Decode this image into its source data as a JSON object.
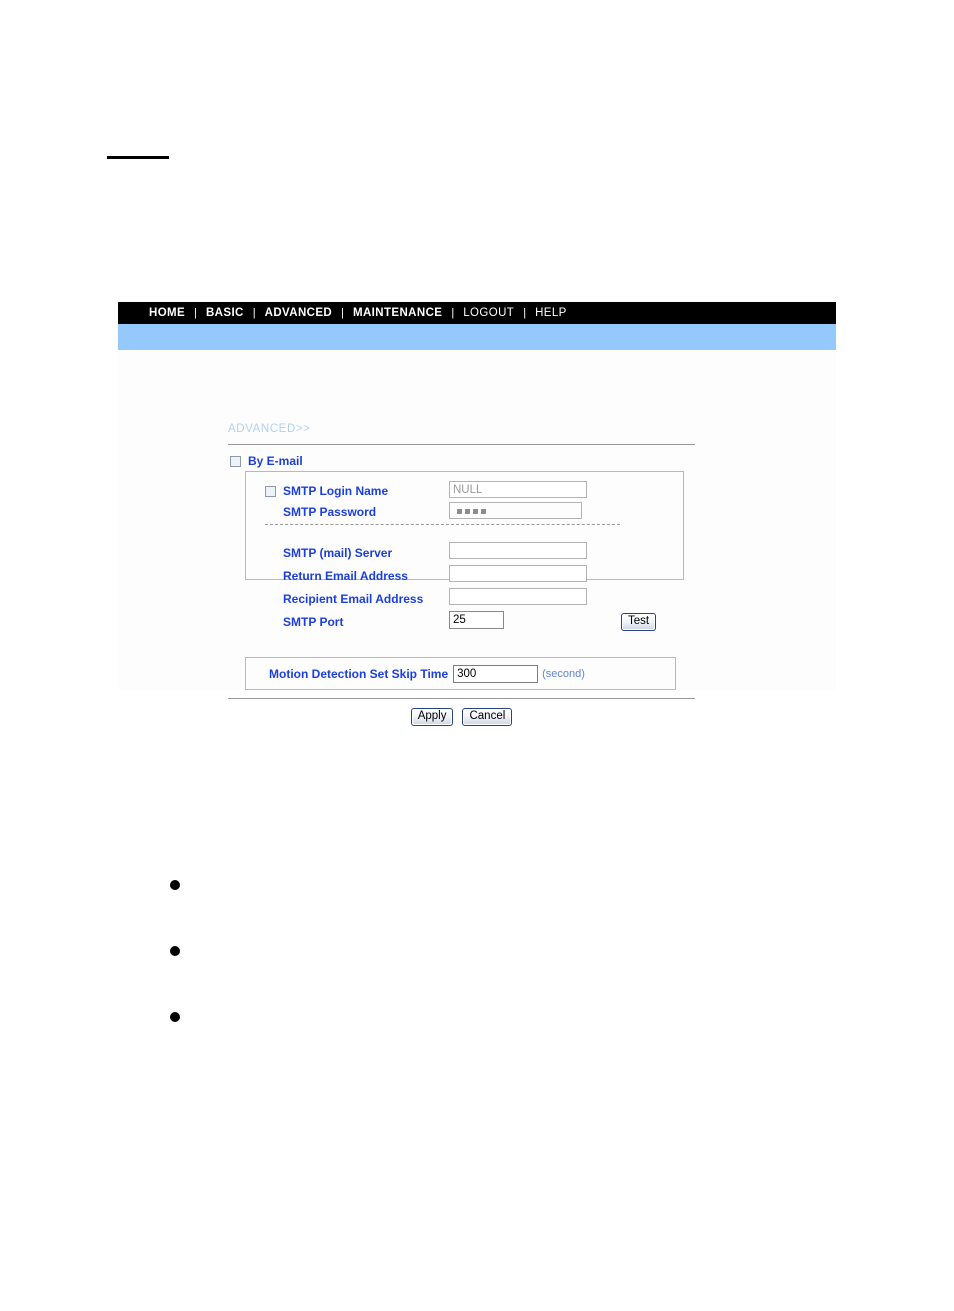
{
  "page": {
    "heading_rule": true,
    "bullets": [
      "",
      "",
      ""
    ]
  },
  "nav": {
    "separator": "|",
    "items": [
      {
        "label": "HOME",
        "weight": "strong"
      },
      {
        "label": "BASIC",
        "weight": "strong"
      },
      {
        "label": "ADVANCED",
        "weight": "strong"
      },
      {
        "label": "MAINTENANCE",
        "weight": "strong"
      },
      {
        "label": "LOGOUT",
        "weight": "light"
      },
      {
        "label": "HELP",
        "weight": "light"
      }
    ]
  },
  "content": {
    "breadcrumb": "ADVANCED>>",
    "master": {
      "label": "By E-mail",
      "checked": false
    },
    "smtp": {
      "login_name": {
        "label": "SMTP Login Name",
        "checked": false,
        "value": "NULL"
      },
      "password": {
        "label": "SMTP Password",
        "value": "••••",
        "dots": 4
      },
      "server": {
        "label": "SMTP (mail) Server",
        "value": "",
        "placeholder": ""
      },
      "return_email": {
        "label": "Return Email Address",
        "value": "",
        "placeholder": ""
      },
      "recipient_email": {
        "label": "Recipient Email Address",
        "value": "",
        "placeholder": ""
      },
      "port": {
        "label": "SMTP Port",
        "value": "25"
      },
      "test_button": "Test"
    },
    "skip_time": {
      "label": "Motion Detection Set Skip Time",
      "value": "300",
      "unit": "(second)"
    },
    "actions": {
      "apply": "Apply",
      "cancel": "Cancel"
    }
  },
  "colors": {
    "navbar_bg": "#000000",
    "banner_bg": "#95c9fb",
    "label_blue": "#1b3fdc",
    "breadcrumb_blue": "#b2d1f0",
    "unit_blue": "#5f86d8",
    "panel_bg": "#fdfdfd",
    "button_border": "#27427e"
  }
}
